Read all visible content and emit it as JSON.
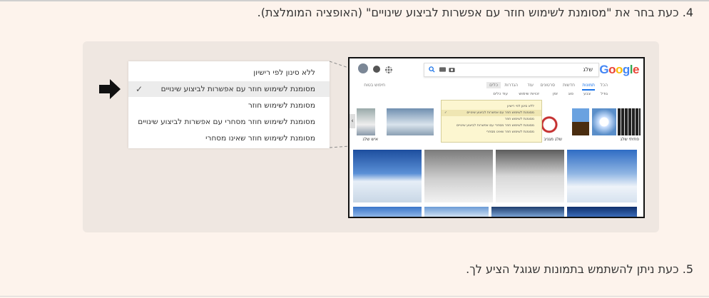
{
  "steps": {
    "step4": "4. כעת בחר את \"מסומנת לשימוש חוזר עם אפשרות לביצוע שינויים\" (האופציה המומלצת).",
    "step5": "5. כעת ניתן להשתמש בתמונות שגוגל הציע לך."
  },
  "zoom_menu": {
    "items": [
      {
        "label": "ללא סינון לפי רישיון",
        "selected": false
      },
      {
        "label": "מסומנת לשימוש חוזר עם אפשרות לביצוע שינויים",
        "selected": true
      },
      {
        "label": "מסומנת לשימוש חוזר",
        "selected": false
      },
      {
        "label": "מסומנת לשימוש חוזר מסחרי עם אפשרות לביצוע שינויים",
        "selected": false
      },
      {
        "label": "מסומנת לשימוש חוזר שאינו מסחרי",
        "selected": false
      }
    ],
    "check_glyph": "✓"
  },
  "screenshot": {
    "logo": "Google",
    "query": "שלג",
    "tabs": [
      {
        "label": "הכל",
        "active": false
      },
      {
        "label": "תמונות",
        "active": true
      },
      {
        "label": "חדשות",
        "active": false
      },
      {
        "label": "סרטונים",
        "active": false
      },
      {
        "label": "עוד",
        "active": false
      },
      {
        "label": "הגדרות",
        "active": false
      },
      {
        "label": "כלים",
        "active": false
      }
    ],
    "safesearch": "חיפוש בטוח",
    "tool_filters": [
      "גודל",
      "צבע",
      "סוג",
      "זמן",
      "זכויות שימוש",
      "עוד כלים"
    ],
    "captions": [
      "פתיתי שלג",
      "שלג מגניב",
      "איש שלג"
    ],
    "popup_items": [
      "ללא סינון לפי רישיון",
      "מסומנת לשימוש חוזר עם אפשרות לביצוע שינויים",
      "מסומנת לשימוש חוזר",
      "מסומנת לשימוש חוזר מסחרי עם אפשרות לביצוע שינויים",
      "מסומנת לשימוש חוזר שאינו מסחרי"
    ]
  },
  "colors": {
    "page_bg": "#fdf3ec",
    "panel_bg": "#efe7e1",
    "google_blue": "#4285f4",
    "google_red": "#ea4335",
    "google_yellow": "#fbbc05",
    "google_green": "#34a853",
    "popup_bg": "#fcf6d0"
  },
  "icons": [
    "arrow-right-icon",
    "check-icon",
    "search-icon",
    "keyboard-icon",
    "camera-icon",
    "apps-icon",
    "notifications-icon",
    "account-icon",
    "chevron-left-icon"
  ]
}
